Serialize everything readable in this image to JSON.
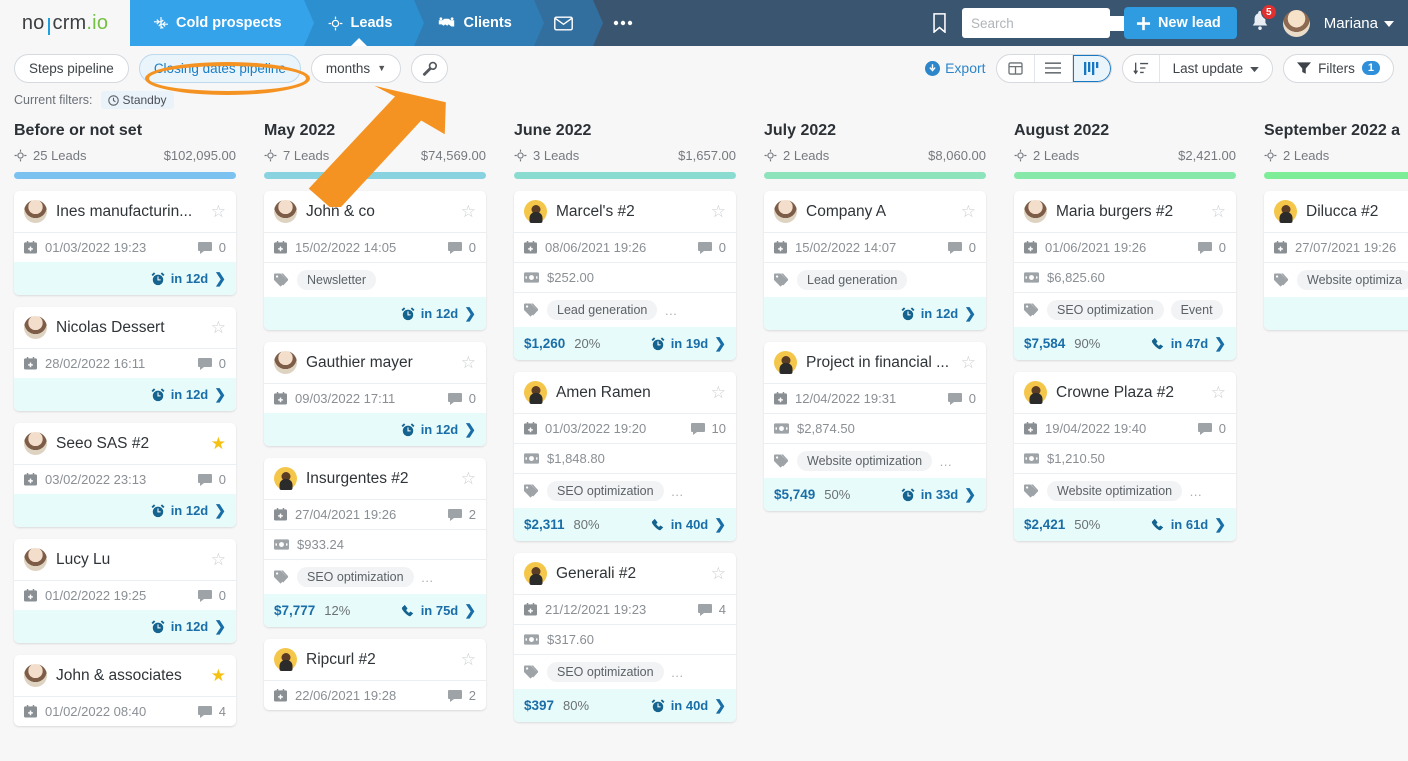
{
  "nav": {
    "brand": {
      "part1": "no",
      "part2": "crm",
      "part3": ".io"
    },
    "tabs": [
      {
        "label": "Cold prospects",
        "icon": "snowflake-icon"
      },
      {
        "label": "Leads",
        "icon": "target-icon"
      },
      {
        "label": "Clients",
        "icon": "handshake-icon"
      },
      {
        "label": "",
        "icon": "envelope-icon"
      },
      {
        "label": "•••",
        "icon": "more-icon"
      }
    ],
    "bookmark_icon": "bookmark-icon",
    "search": {
      "placeholder": "Search",
      "value": ""
    },
    "new_lead_label": "New lead",
    "notifications_count": "5",
    "user_name": "Mariana"
  },
  "toolbar": {
    "steps_pipeline": "Steps pipeline",
    "closing_dates_pipeline": "Closing dates pipeline",
    "period": "months",
    "wrench_icon": "wrench-icon",
    "export": "Export",
    "views": [
      {
        "name": "grid-view-icon",
        "selected": false
      },
      {
        "name": "list-view-icon",
        "selected": false
      },
      {
        "name": "kanban-view-icon",
        "selected": true
      }
    ],
    "sort_label": "Last update",
    "filters_label": "Filters",
    "filters_count": "1",
    "current_filters_label": "Current filters:",
    "current_filter_chip": "Standby"
  },
  "columns": [
    {
      "title": "Before or not set",
      "leads": "25 Leads",
      "amount": "$102,095.00",
      "bar_color": "#7cc2f0",
      "cards": [
        {
          "title": "Ines manufacturin...",
          "avatar": "av-a",
          "starred": false,
          "date": "01/03/2022 19:23",
          "comments": "0",
          "price": null,
          "tags": [],
          "tags_more": false,
          "foot": {
            "amount": null,
            "pct": null,
            "icon": "alarm-icon",
            "due": "in 12d"
          }
        },
        {
          "title": "Nicolas Dessert",
          "avatar": "av-a",
          "starred": false,
          "date": "28/02/2022 16:11",
          "comments": "0",
          "price": null,
          "tags": [],
          "tags_more": false,
          "foot": {
            "amount": null,
            "pct": null,
            "icon": "alarm-icon",
            "due": "in 12d"
          }
        },
        {
          "title": "Seeo SAS #2",
          "avatar": "av-a",
          "starred": true,
          "date": "03/02/2022 23:13",
          "comments": "0",
          "price": null,
          "tags": [],
          "tags_more": false,
          "foot": {
            "amount": null,
            "pct": null,
            "icon": "alarm-icon",
            "due": "in 12d"
          }
        },
        {
          "title": "Lucy Lu",
          "avatar": "av-a",
          "starred": false,
          "date": "01/02/2022 19:25",
          "comments": "0",
          "price": null,
          "tags": [],
          "tags_more": false,
          "foot": {
            "amount": null,
            "pct": null,
            "icon": "alarm-icon",
            "due": "in 12d"
          }
        },
        {
          "title": "John & associates",
          "avatar": "av-a",
          "starred": true,
          "date": "01/02/2022 08:40",
          "comments": "4",
          "price": null,
          "tags": [],
          "tags_more": false,
          "foot": null
        }
      ]
    },
    {
      "title": "May 2022",
      "leads": "7 Leads",
      "amount": "$74,569.00",
      "bar_color": "#89d3e0",
      "cards": [
        {
          "title": "John & co",
          "avatar": "av-a",
          "starred": false,
          "date": "15/02/2022 14:05",
          "comments": "0",
          "price": null,
          "tags": [
            "Newsletter"
          ],
          "tags_more": false,
          "foot": {
            "amount": null,
            "pct": null,
            "icon": "alarm-icon",
            "due": "in 12d"
          }
        },
        {
          "title": "Gauthier mayer",
          "avatar": "av-a",
          "starred": false,
          "date": "09/03/2022 17:11",
          "comments": "0",
          "price": null,
          "tags": [],
          "tags_more": false,
          "foot": {
            "amount": null,
            "pct": null,
            "icon": "alarm-icon",
            "due": "in 12d"
          }
        },
        {
          "title": "Insurgentes #2",
          "avatar": "av-b",
          "starred": false,
          "date": "27/04/2021 19:26",
          "comments": "2",
          "price": "$933.24",
          "tags": [
            "SEO optimization"
          ],
          "tags_more": true,
          "foot": {
            "amount": "$7,777",
            "pct": "12%",
            "icon": "phone-icon",
            "due": "in 75d"
          }
        },
        {
          "title": "Ripcurl #2",
          "avatar": "av-b",
          "starred": false,
          "date": "22/06/2021 19:28",
          "comments": "2",
          "price": null,
          "tags": [],
          "tags_more": false,
          "foot": null
        }
      ]
    },
    {
      "title": "June 2022",
      "leads": "3 Leads",
      "amount": "$1,657.00",
      "bar_color": "#8adcd0",
      "cards": [
        {
          "title": "Marcel's #2",
          "avatar": "av-b",
          "starred": false,
          "date": "08/06/2021 19:26",
          "comments": "0",
          "price": "$252.00",
          "tags": [
            "Lead generation"
          ],
          "tags_more": true,
          "foot": {
            "amount": "$1,260",
            "pct": "20%",
            "icon": "alarm-icon",
            "due": "in 19d"
          }
        },
        {
          "title": "Amen Ramen",
          "avatar": "av-b",
          "starred": false,
          "date": "01/03/2022 19:20",
          "comments": "10",
          "price": "$1,848.80",
          "tags": [
            "SEO optimization"
          ],
          "tags_more": true,
          "foot": {
            "amount": "$2,311",
            "pct": "80%",
            "icon": "phone-icon",
            "due": "in 40d"
          }
        },
        {
          "title": "Generali #2",
          "avatar": "av-b",
          "starred": false,
          "date": "21/12/2021 19:23",
          "comments": "4",
          "price": "$317.60",
          "tags": [
            "SEO optimization"
          ],
          "tags_more": true,
          "foot": {
            "amount": "$397",
            "pct": "80%",
            "icon": "alarm-icon",
            "due": "in 40d"
          }
        }
      ]
    },
    {
      "title": "July 2022",
      "leads": "2 Leads",
      "amount": "$8,060.00",
      "bar_color": "#8ce3bc",
      "cards": [
        {
          "title": "Company A",
          "avatar": "av-a",
          "starred": false,
          "date": "15/02/2022 14:07",
          "comments": "0",
          "price": null,
          "tags": [
            "Lead generation"
          ],
          "tags_more": false,
          "foot": {
            "amount": null,
            "pct": null,
            "icon": "alarm-icon",
            "due": "in 12d"
          }
        },
        {
          "title": "Project in financial ...",
          "avatar": "av-b",
          "starred": false,
          "date": "12/04/2022 19:31",
          "comments": "0",
          "price": "$2,874.50",
          "tags": [
            "Website optimization"
          ],
          "tags_more": true,
          "foot": {
            "amount": "$5,749",
            "pct": "50%",
            "icon": "alarm-icon",
            "due": "in 33d"
          }
        }
      ]
    },
    {
      "title": "August 2022",
      "leads": "2 Leads",
      "amount": "$2,421.00",
      "bar_color": "#86e9a9",
      "cards": [
        {
          "title": "Maria burgers #2",
          "avatar": "av-a",
          "starred": false,
          "date": "01/06/2021 19:26",
          "comments": "0",
          "price": "$6,825.60",
          "tags": [
            "SEO optimization",
            "Event"
          ],
          "tags_more": true,
          "foot": {
            "amount": "$7,584",
            "pct": "90%",
            "icon": "phone-icon",
            "due": "in 47d"
          }
        },
        {
          "title": "Crowne Plaza #2",
          "avatar": "av-b",
          "starred": false,
          "date": "19/04/2022 19:40",
          "comments": "0",
          "price": "$1,210.50",
          "tags": [
            "Website optimization"
          ],
          "tags_more": true,
          "foot": {
            "amount": "$2,421",
            "pct": "50%",
            "icon": "phone-icon",
            "due": "in 61d"
          }
        }
      ]
    },
    {
      "title": "September 2022 a",
      "leads": "2 Leads",
      "amount": "",
      "bar_color": "#7ded97",
      "cards": [
        {
          "title": "Dilucca #2",
          "avatar": "av-b",
          "starred": false,
          "date": "27/07/2021 19:26",
          "comments": "",
          "price": null,
          "tags": [
            "Website optimiza"
          ],
          "tags_more": false,
          "foot": {
            "amount": null,
            "pct": null,
            "icon": null,
            "due": ""
          }
        }
      ]
    }
  ]
}
